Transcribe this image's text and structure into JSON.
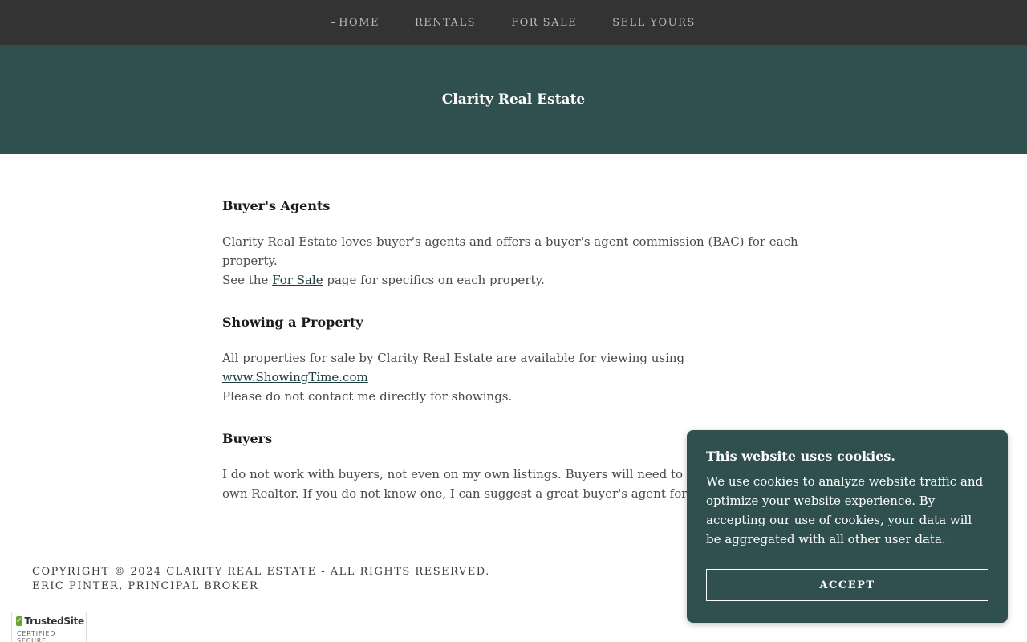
{
  "nav": {
    "items": [
      {
        "label": "HOME",
        "active": true
      },
      {
        "label": "RENTALS",
        "active": false
      },
      {
        "label": "FOR SALE",
        "active": false
      },
      {
        "label": "SELL YOURS",
        "active": false
      }
    ]
  },
  "hero": {
    "title": "Clarity Real Estate"
  },
  "sections": [
    {
      "heading": "Buyer's Agents",
      "paragraph": {
        "line1": "Clarity Real Estate loves buyer's agents and offers a buyer's agent commission (BAC) for each property.",
        "line2_before": "See the ",
        "link": "For Sale",
        "line2_after": " page for specifics on each property."
      }
    },
    {
      "heading": "Showing a Property",
      "paragraph": {
        "line1_before": "All properties for sale by Clarity Real Estate are available for viewing using ",
        "link": "www.ShowingTime.com",
        "line2": "Please do not contact me directly for showings."
      }
    },
    {
      "heading": "Buyers",
      "paragraph": {
        "text": "I do not work with buyers, not even on my own listings.  Buyers will need to go through their own Realtor.  If you do not know one, I can suggest a great buyer's agent for you to contact."
      }
    }
  ],
  "footer": {
    "copyright": "COPYRIGHT © 2024 CLARITY REAL ESTATE - ALL RIGHTS RESERVED.",
    "broker": "ERIC PINTER, PRINCIPAL BROKER"
  },
  "trusted_badge": {
    "brand": "TrustedSite",
    "sub": "CERTIFIED SECURE",
    "check_icon": "✓"
  },
  "cookie": {
    "title": "This website uses cookies.",
    "body": "We use cookies to analyze website traffic and optimize your website experience. By accepting our use of cookies, your data will be aggregated with all other user data.",
    "accept_label": "ACCEPT"
  },
  "colors": {
    "nav_bg": "#333333",
    "hero_bg": "#2f504f",
    "cookie_bg": "#2f504f"
  }
}
